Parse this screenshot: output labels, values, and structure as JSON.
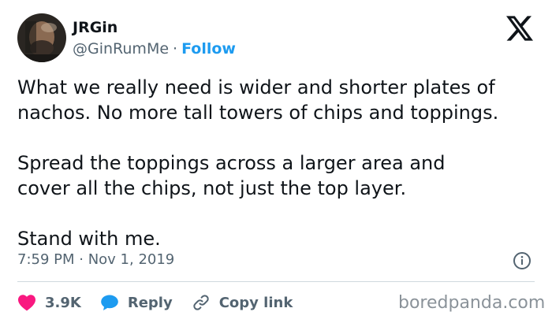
{
  "author": {
    "name": "JRGin",
    "handle": "@GinRumMe",
    "separator": "·",
    "follow_label": "Follow"
  },
  "tweet": {
    "lines": [
      "What we really need is wider and shorter plates of",
      "nachos. No more tall towers of chips and toppings.",
      "Spread the toppings across a larger area and",
      "cover all the chips, not just the top layer.",
      "Stand with me."
    ],
    "timestamp": "7:59 PM · Nov 1, 2019"
  },
  "actions": {
    "likes_count": "3.9K",
    "reply_label": "Reply",
    "copy_link_label": "Copy link"
  },
  "watermark": "boredpanda.com",
  "colors": {
    "accent": "#1d9bf0",
    "like": "#f91880",
    "muted": "#536471",
    "text": "#0f1419",
    "divider": "#cfd9de"
  },
  "icons": {
    "platform": "x-logo-icon",
    "info": "info-icon",
    "like": "heart-icon",
    "reply": "reply-bubble-icon",
    "copy_link": "link-icon"
  }
}
